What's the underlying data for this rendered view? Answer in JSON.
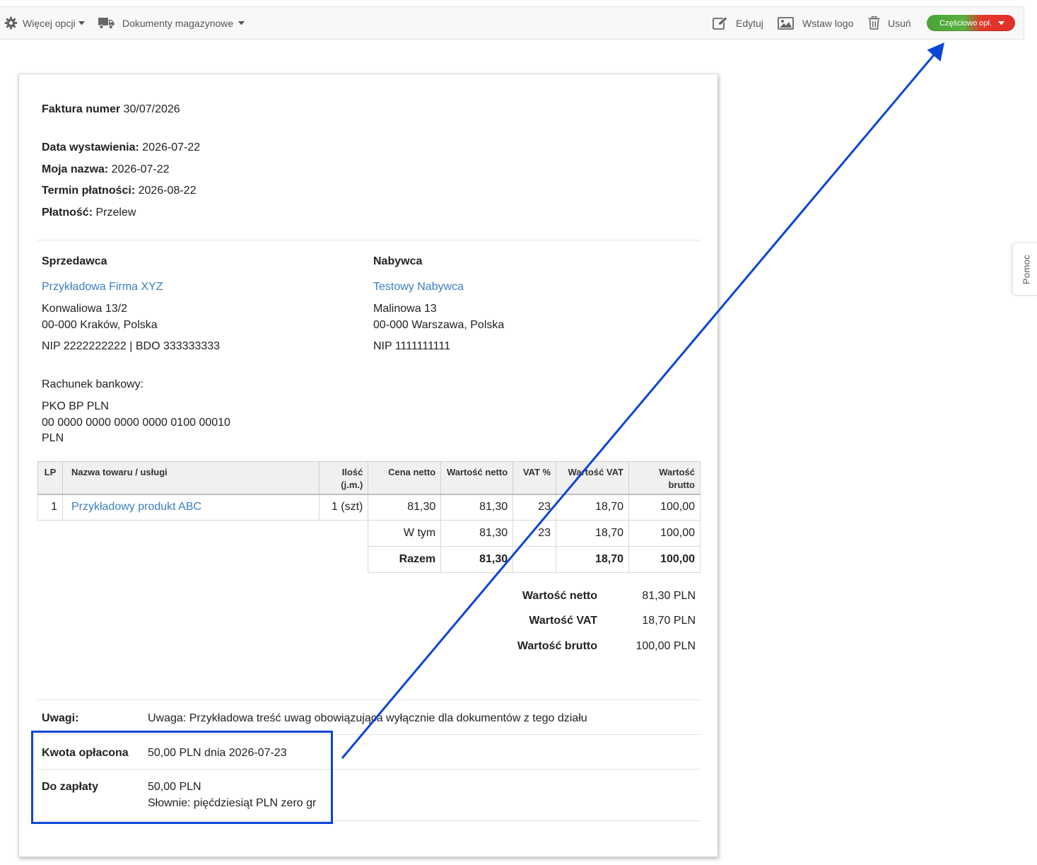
{
  "toolbar": {
    "more_options": "Więcej opcji",
    "warehouse_docs": "Dokumenty magazynowe",
    "edit": "Edytuj",
    "insert_logo": "Wstaw logo",
    "delete": "Usuń",
    "status": "Częściowo opł."
  },
  "help_tab": "Pomoc",
  "invoice": {
    "number_label": "Faktura numer",
    "number": "30/07/2026",
    "fields": [
      {
        "label": "Data wystawienia:",
        "value": "2026-07-22"
      },
      {
        "label": "Moja nazwa:",
        "value": "2026-07-22"
      },
      {
        "label": "Termin płatności:",
        "value": "2026-08-22"
      },
      {
        "label": "Płatność:",
        "value": "Przelew"
      }
    ],
    "seller": {
      "heading": "Sprzedawca",
      "name": "Przykładowa Firma XYZ",
      "address1": "Konwaliowa 13/2",
      "address2": "00-000 Kraków, Polska",
      "ids": "NIP 2222222222 | BDO 333333333"
    },
    "buyer": {
      "heading": "Nabywca",
      "name": "Testowy Nabywca",
      "address1": "Malinowa 13",
      "address2": "00-000 Warszawa, Polska",
      "ids": "NIP 1111111111"
    },
    "bank": {
      "label": "Rachunek bankowy:",
      "name": "PKO BP PLN",
      "account": "00 0000 0000 0000 0000 0100 00010",
      "currency": "PLN"
    },
    "table": {
      "headers": {
        "lp": "LP",
        "name": "Nazwa towaru / usługi",
        "qty_1": "Ilość",
        "qty_2": "(j.m.)",
        "net_price": "Cena netto",
        "net_value": "Wartość netto",
        "vat_pct": "VAT %",
        "vat_value": "Wartość VAT",
        "gross_value": "Wartość brutto"
      },
      "rows": [
        {
          "lp": "1",
          "name": "Przykładowy produkt ABC",
          "qty": "1 (szt)",
          "net_price": "81,30",
          "net_value": "81,30",
          "vat_pct": "23",
          "vat_value": "18,70",
          "gross_value": "100,00"
        }
      ],
      "including": {
        "label": "W tym",
        "net_value": "81,30",
        "vat_pct": "23",
        "vat_value": "18,70",
        "gross_value": "100,00"
      },
      "total": {
        "label": "Razem",
        "net_value": "81,30",
        "vat_value": "18,70",
        "gross_value": "100,00"
      }
    },
    "summary": [
      {
        "label": "Wartość netto",
        "value": "81,30 PLN"
      },
      {
        "label": "Wartość VAT",
        "value": "18,70 PLN"
      },
      {
        "label": "Wartość brutto",
        "value": "100,00 PLN"
      }
    ],
    "notes": {
      "label": "Uwagi:",
      "text": "Uwaga: Przykładowa treść uwag obowiązująca wyłącznie dla dokumentów z tego działu"
    },
    "paid": {
      "label": "Kwota opłacona",
      "text": "50,00 PLN dnia 2026-07-23"
    },
    "due": {
      "label": "Do zapłaty",
      "amount": "50,00 PLN",
      "words": "Słownie: pięćdziesiąt PLN zero gr"
    }
  },
  "colors": {
    "link": "#3a7fbf",
    "annotation": "#0a47d6",
    "status_green": "#5bb03f",
    "status_red": "#e0302a"
  }
}
